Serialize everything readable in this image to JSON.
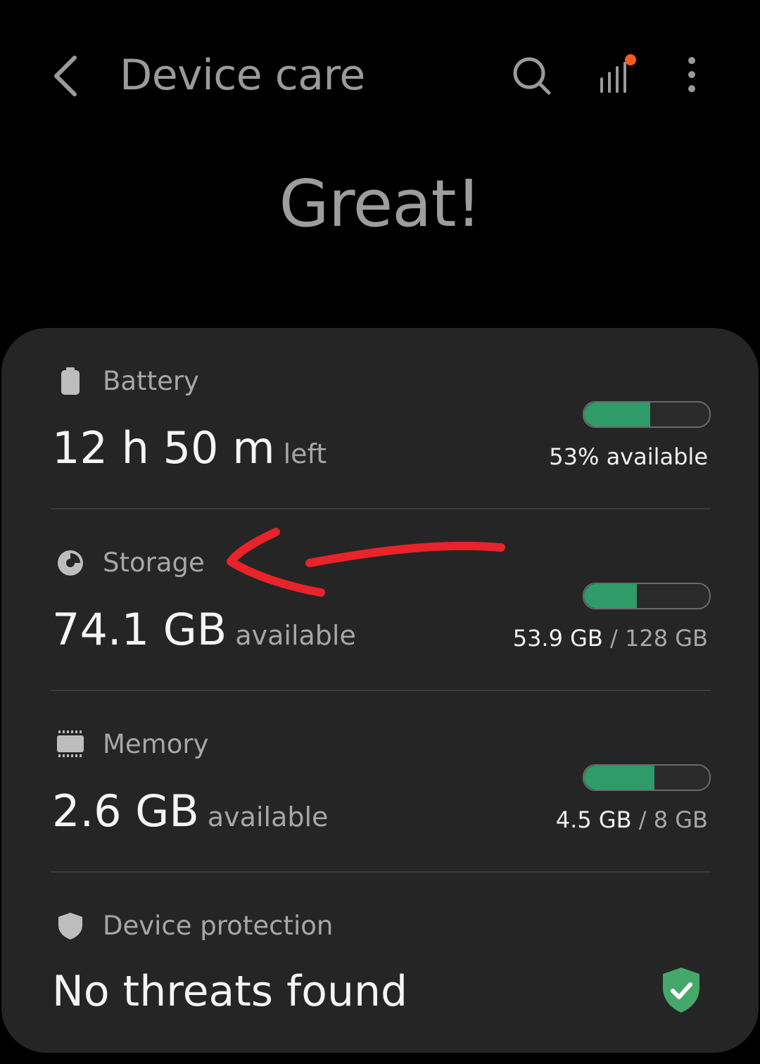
{
  "header": {
    "title": "Device care",
    "icons": [
      "back-icon",
      "search-icon",
      "stats-icon",
      "more-options-icon"
    ]
  },
  "status": {
    "headline": "Great!"
  },
  "battery": {
    "label": "Battery",
    "value": "12 h 50 m",
    "suffix": "left",
    "bar_text": "53% available",
    "fill_fraction": 0.53
  },
  "storage": {
    "label": "Storage",
    "value": "74.1 GB",
    "suffix": "available",
    "used": "53.9 GB",
    "separator": "/",
    "total": "128 GB",
    "fill_fraction": 0.42
  },
  "memory": {
    "label": "Memory",
    "value": "2.6 GB",
    "suffix": "available",
    "used": "4.5 GB",
    "separator": "/",
    "total": "8 GB",
    "fill_fraction": 0.56
  },
  "protection": {
    "label": "Device protection",
    "value": "No threats found"
  },
  "colors": {
    "accent_green": "#2e9b68",
    "notification_dot": "#ff5a1f",
    "annotation_red": "#e8232a",
    "card_bg": "#252525"
  }
}
